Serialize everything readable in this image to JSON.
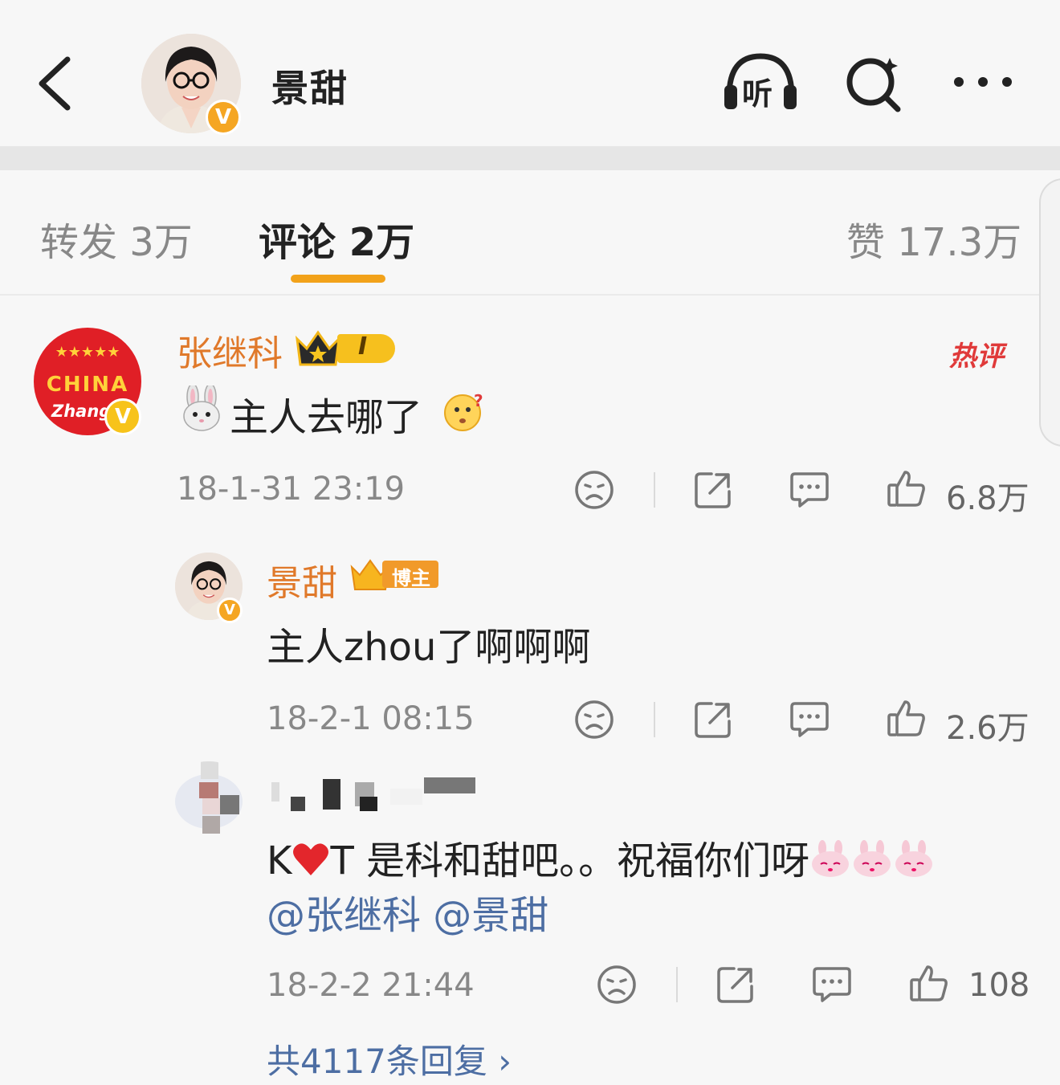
{
  "header": {
    "title": "景甜",
    "listen_label": "听"
  },
  "tabs": {
    "repost": "转发 3万",
    "comments": "评论 2万",
    "likes": "赞 17.3万"
  },
  "colors": {
    "accent": "#f2a21a",
    "name": "#e0792a",
    "link": "#4d6ea3",
    "hot": "#e03a3a"
  },
  "comments": [
    {
      "name": "张继科",
      "level_badge": "I",
      "avatar_text_top": "★★★★★",
      "avatar_text_mid": "CHINA",
      "avatar_text_bottom": "Zhang",
      "hot_tag": "热评",
      "text": "主人去哪了",
      "time": "18-1-31 23:19",
      "likes": "6.8万"
    },
    {
      "name": "景甜",
      "role_badge": "博主",
      "text": "主人zhou了啊啊啊",
      "time": "18-2-1 08:15",
      "likes": "2.6万"
    },
    {
      "text_prefix": "K",
      "text_suffix": "T 是科和甜吧。。祝福你们呀",
      "mention_1": "@张继科",
      "mention_2": "@景甜",
      "time": "18-2-2 21:44",
      "likes": "108"
    }
  ],
  "reply_all": "共4117条回复 ›",
  "icons": [
    "back-icon",
    "listen-icon",
    "search-icon",
    "more-icon",
    "dislike-icon",
    "share-icon",
    "comment-icon",
    "like-icon",
    "rabbit-emoji-icon",
    "confused-emoji-icon",
    "heart-icon",
    "bunny-emoji-icon"
  ]
}
